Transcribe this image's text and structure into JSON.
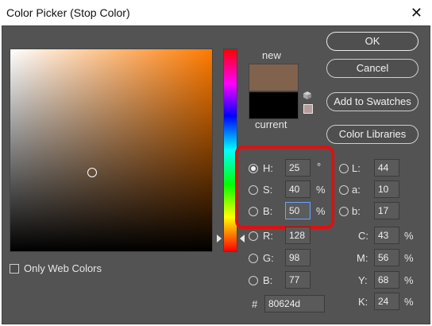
{
  "window": {
    "title": "Color Picker (Stop Color)",
    "close_glyph": "✕"
  },
  "preview": {
    "new_label": "new",
    "current_label": "current",
    "new_color": "#80624d",
    "current_color": "#000000"
  },
  "buttons": {
    "ok": "OK",
    "cancel": "Cancel",
    "add_to_swatches": "Add to Swatches",
    "color_libraries": "Color Libraries"
  },
  "options": {
    "only_web_colors": "Only Web Colors"
  },
  "hsb": {
    "h": {
      "label": "H:",
      "value": "25",
      "unit": "°"
    },
    "s": {
      "label": "S:",
      "value": "40",
      "unit": "%"
    },
    "b": {
      "label": "B:",
      "value": "50",
      "unit": "%"
    }
  },
  "lab": {
    "l": {
      "label": "L:",
      "value": "44"
    },
    "a": {
      "label": "a:",
      "value": "10"
    },
    "b": {
      "label": "b:",
      "value": "17"
    }
  },
  "rgb": {
    "r": {
      "label": "R:",
      "value": "128"
    },
    "g": {
      "label": "G:",
      "value": "98"
    },
    "b": {
      "label": "B:",
      "value": "77"
    }
  },
  "cmyk": {
    "c": {
      "label": "C:",
      "value": "43",
      "unit": "%"
    },
    "m": {
      "label": "M:",
      "value": "56",
      "unit": "%"
    },
    "y": {
      "label": "Y:",
      "value": "68",
      "unit": "%"
    },
    "k": {
      "label": "K:",
      "value": "24",
      "unit": "%"
    }
  },
  "hex": {
    "label": "#",
    "value": "80624d"
  },
  "colors": {
    "hue_field": "#ff7a00",
    "highlight_box": "#e01010",
    "accent_field_border": "#6aa3ff"
  }
}
